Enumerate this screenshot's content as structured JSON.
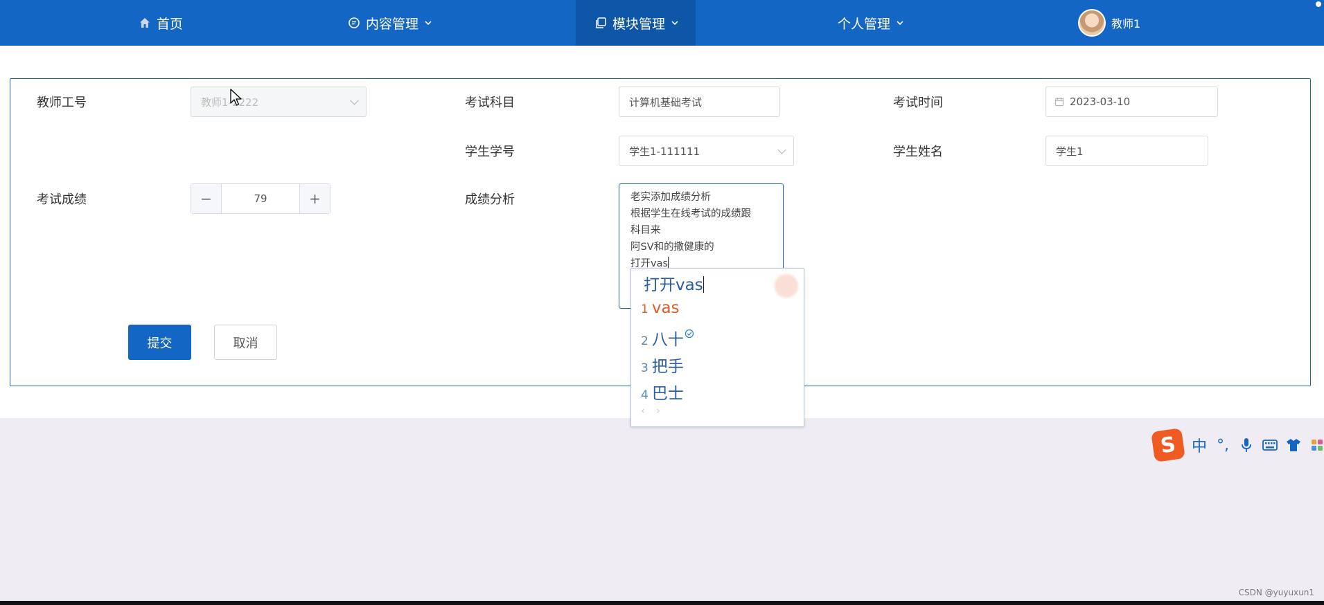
{
  "nav": {
    "home": "首页",
    "content_mgmt": "内容管理",
    "module_mgmt": "模块管理",
    "personal_mgmt": "个人管理",
    "user_name": "教师1"
  },
  "form": {
    "teacher_id": {
      "label": "教师工号",
      "value": "教师1-2222"
    },
    "exam_subject": {
      "label": "考试科目",
      "value": "计算机基础考试"
    },
    "exam_time": {
      "label": "考试时间",
      "value": "2023-03-10"
    },
    "student_id": {
      "label": "学生学号",
      "value": "学生1-111111"
    },
    "student_name": {
      "label": "学生姓名",
      "value": "学生1"
    },
    "exam_score": {
      "label": "考试成绩",
      "value": "79",
      "minus": "−",
      "plus": "+"
    },
    "analysis": {
      "label": "成绩分析",
      "lines": [
        "老实添加成绩分析",
        "根据学生在线考试的成绩跟",
        "科目来",
        "阿SV和的撒健康的",
        "打开vas"
      ]
    },
    "submit": "提交",
    "cancel": "取消"
  },
  "ime": {
    "composition": "打开vas",
    "candidates": [
      {
        "num": "1",
        "text": "vas"
      },
      {
        "num": "2",
        "text": "八十"
      },
      {
        "num": "3",
        "text": "把手"
      },
      {
        "num": "4",
        "text": "巴士"
      }
    ],
    "pager_prev": "‹",
    "pager_next": "›",
    "toolbar": {
      "logo": "S",
      "mode": "中",
      "punct": "°,"
    }
  },
  "watermark": "CSDN @yuyuxun1"
}
